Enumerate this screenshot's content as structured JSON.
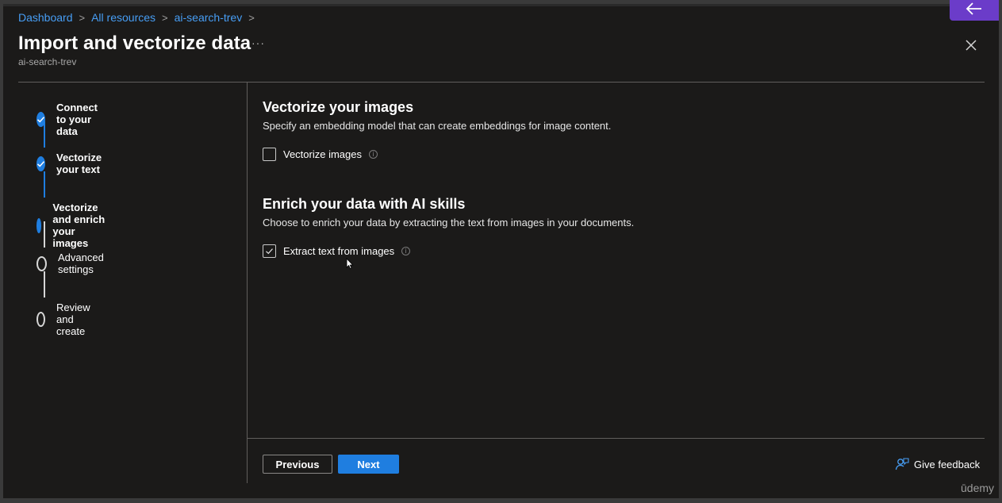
{
  "breadcrumb": [
    "Dashboard",
    "All resources",
    "ai-search-trev"
  ],
  "page": {
    "title": "Import and vectorize data",
    "subtitle": "ai-search-trev",
    "more_label": "···"
  },
  "steps": [
    {
      "label": "Connect to your data",
      "state": "done"
    },
    {
      "label": "Vectorize your text",
      "state": "done"
    },
    {
      "label": "Vectorize and enrich your images",
      "state": "current"
    },
    {
      "label": "Advanced settings",
      "state": "todo"
    },
    {
      "label": "Review and create",
      "state": "todo"
    }
  ],
  "sections": {
    "vectorize": {
      "heading": "Vectorize your images",
      "description": "Specify an embedding model that can create embeddings for image content.",
      "checkbox_label": "Vectorize images",
      "checked": false
    },
    "enrich": {
      "heading": "Enrich your data with AI skills",
      "description": "Choose to enrich your data by extracting the text from images in your documents.",
      "checkbox_label": "Extract text from images",
      "checked": true
    }
  },
  "footer": {
    "previous_label": "Previous",
    "next_label": "Next",
    "feedback_label": "Give feedback"
  },
  "watermark": "ūdemy",
  "colors": {
    "accent": "#1f7ee0",
    "link": "#479ef5",
    "background": "#1b1a19",
    "overlay_button": "#6b3cc9"
  },
  "icons": {
    "close": "close-icon",
    "back": "arrow-left-icon",
    "feedback": "feedback-person-icon",
    "info": "info-icon",
    "check": "checkmark-icon"
  }
}
